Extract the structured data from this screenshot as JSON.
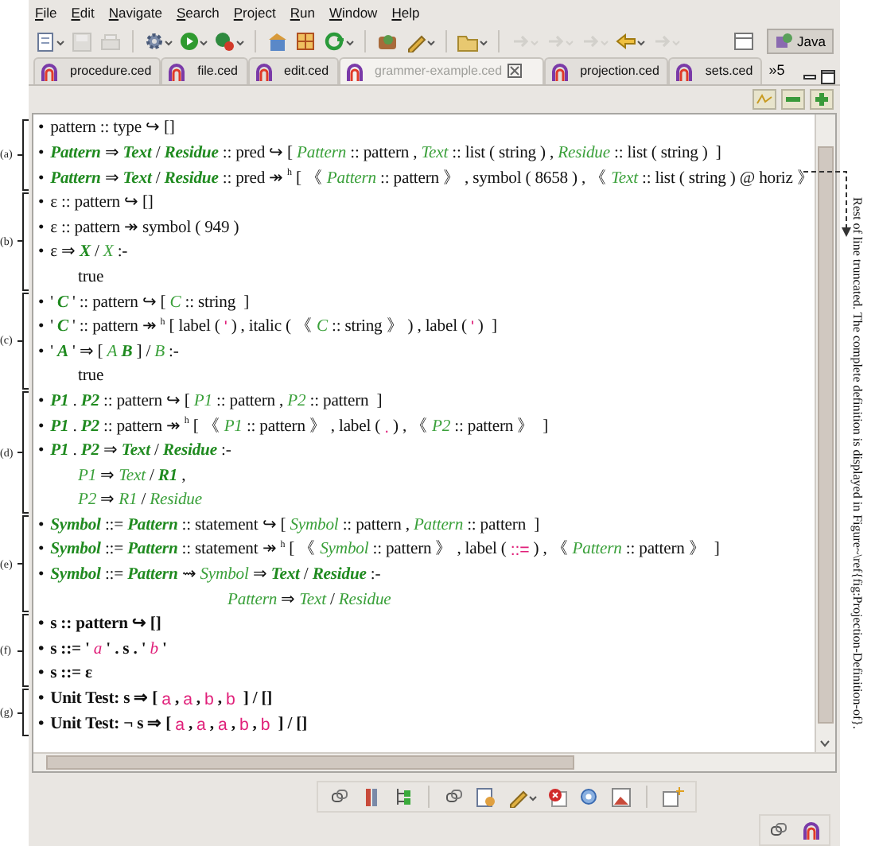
{
  "menu": [
    {
      "label": "File"
    },
    {
      "label": "Edit"
    },
    {
      "label": "Navigate"
    },
    {
      "label": "Search"
    },
    {
      "label": "Project"
    },
    {
      "label": "Run"
    },
    {
      "label": "Window"
    },
    {
      "label": "Help"
    }
  ],
  "perspective": {
    "label": "Java",
    "selected": true
  },
  "tabs": [
    {
      "label": "procedure.ced",
      "selected": false
    },
    {
      "label": "file.ced",
      "selected": false
    },
    {
      "label": "edit.ced",
      "selected": false
    },
    {
      "label": "grammer-example.ced",
      "selected": true
    },
    {
      "label": "projection.ced",
      "selected": false
    },
    {
      "label": "sets.ced",
      "selected": false
    }
  ],
  "tab_overflow": "»5",
  "groups": [
    {
      "label": "(a)",
      "strong": false,
      "lines": [
        {
          "kind": "item",
          "bullet": "•",
          "segs": [
            {
              "kind": "plain",
              "text": "pattern :: type ↪ []"
            }
          ]
        },
        {
          "kind": "item",
          "bullet": "•",
          "segs": [
            {
              "kind": "var",
              "text": "Pattern"
            },
            {
              "kind": "plain",
              "text": " ⇒ "
            },
            {
              "kind": "var",
              "text": "Text"
            },
            {
              "kind": "plain",
              "text": " / "
            },
            {
              "kind": "var",
              "text": "Residue"
            },
            {
              "kind": "plain",
              "text": " :: pred ↪ [ "
            },
            {
              "kind": "param",
              "text": "Pattern"
            },
            {
              "kind": "plain",
              "text": " :: pattern , "
            },
            {
              "kind": "param",
              "text": "Text"
            },
            {
              "kind": "plain",
              "text": " :: list ( string ) , "
            },
            {
              "kind": "param",
              "text": "Residue"
            },
            {
              "kind": "plain",
              "text": " :: list ( string )  ]"
            }
          ]
        },
        {
          "kind": "item",
          "bullet": "•",
          "segs": [
            {
              "kind": "var",
              "text": "Pattern"
            },
            {
              "kind": "plain",
              "text": " ⇒ "
            },
            {
              "kind": "var",
              "text": "Text"
            },
            {
              "kind": "plain",
              "text": " / "
            },
            {
              "kind": "var",
              "text": "Residue"
            },
            {
              "kind": "plain",
              "text": " :: pred ↠ "
            },
            {
              "kind": "sup",
              "text": "h"
            },
            {
              "kind": "plain",
              "text": " [ 《 "
            },
            {
              "kind": "param",
              "text": "Pattern"
            },
            {
              "kind": "plain",
              "text": " :: pattern 》 , symbol ( 8658 ) , 《 "
            },
            {
              "kind": "param",
              "text": "Text"
            },
            {
              "kind": "plain",
              "text": " :: list ( string ) @ horiz 》"
            }
          ]
        }
      ]
    },
    {
      "label": "(b)",
      "strong": false,
      "lines": [
        {
          "kind": "item",
          "bullet": "•",
          "segs": [
            {
              "kind": "plain",
              "text": "ε :: pattern ↪ []"
            }
          ]
        },
        {
          "kind": "item",
          "bullet": "•",
          "segs": [
            {
              "kind": "plain",
              "text": "ε :: pattern ↠ symbol ( 949 )"
            }
          ]
        },
        {
          "kind": "item",
          "bullet": "•",
          "segs": [
            {
              "kind": "plain",
              "text": "ε ⇒ "
            },
            {
              "kind": "var",
              "text": "X"
            },
            {
              "kind": "plain",
              "text": " / "
            },
            {
              "kind": "param",
              "text": "X"
            },
            {
              "kind": "plain",
              "text": " :-"
            }
          ]
        },
        {
          "kind": "cont",
          "segs": [
            {
              "kind": "plain",
              "text": "true"
            }
          ]
        }
      ]
    },
    {
      "label": "(c)",
      "strong": false,
      "lines": [
        {
          "kind": "item",
          "bullet": "•",
          "segs": [
            {
              "kind": "plain",
              "text": "' "
            },
            {
              "kind": "var",
              "text": "C"
            },
            {
              "kind": "plain",
              "text": " ' :: pattern ↪ [ "
            },
            {
              "kind": "param",
              "text": "C"
            },
            {
              "kind": "plain",
              "text": " :: string  ]"
            }
          ]
        },
        {
          "kind": "item",
          "bullet": "•",
          "segs": [
            {
              "kind": "plain",
              "text": "' "
            },
            {
              "kind": "var",
              "text": "C"
            },
            {
              "kind": "plain",
              "text": " ' :: pattern ↠ "
            },
            {
              "kind": "sup",
              "text": "h"
            },
            {
              "kind": "plain",
              "text": " [ label ( "
            },
            {
              "kind": "literal",
              "text": "'"
            },
            {
              "kind": "plain",
              "text": " ) , italic ( 《 "
            },
            {
              "kind": "param",
              "text": "C"
            },
            {
              "kind": "plain",
              "text": " :: string 》 ) , label ( "
            },
            {
              "kind": "literal",
              "text": "'"
            },
            {
              "kind": "plain",
              "text": " )  ]"
            }
          ]
        },
        {
          "kind": "item",
          "bullet": "•",
          "segs": [
            {
              "kind": "plain",
              "text": "' "
            },
            {
              "kind": "var",
              "text": "A"
            },
            {
              "kind": "plain",
              "text": " ' ⇒ [ "
            },
            {
              "kind": "param",
              "text": "A"
            },
            {
              "kind": "var",
              "text": " B"
            },
            {
              "kind": "plain",
              "text": " ] / "
            },
            {
              "kind": "param",
              "text": "B"
            },
            {
              "kind": "plain",
              "text": " :-"
            }
          ]
        },
        {
          "kind": "cont",
          "segs": [
            {
              "kind": "plain",
              "text": "true"
            }
          ]
        }
      ]
    },
    {
      "label": "(d)",
      "strong": false,
      "lines": [
        {
          "kind": "item",
          "bullet": "•",
          "segs": [
            {
              "kind": "var",
              "text": "P1"
            },
            {
              "kind": "plain",
              "text": " . "
            },
            {
              "kind": "var",
              "text": "P2"
            },
            {
              "kind": "plain",
              "text": " :: pattern ↪ [ "
            },
            {
              "kind": "param",
              "text": "P1"
            },
            {
              "kind": "plain",
              "text": " :: pattern , "
            },
            {
              "kind": "param",
              "text": "P2"
            },
            {
              "kind": "plain",
              "text": " :: pattern  ]"
            }
          ]
        },
        {
          "kind": "item",
          "bullet": "•",
          "segs": [
            {
              "kind": "var",
              "text": "P1"
            },
            {
              "kind": "plain",
              "text": " . "
            },
            {
              "kind": "var",
              "text": "P2"
            },
            {
              "kind": "plain",
              "text": " :: pattern ↠ "
            },
            {
              "kind": "sup",
              "text": "h"
            },
            {
              "kind": "plain",
              "text": " [ 《 "
            },
            {
              "kind": "param",
              "text": "P1"
            },
            {
              "kind": "plain",
              "text": " :: pattern 》 , label ( "
            },
            {
              "kind": "literal",
              "text": "."
            },
            {
              "kind": "plain",
              "text": " ) , 《 "
            },
            {
              "kind": "param",
              "text": "P2"
            },
            {
              "kind": "plain",
              "text": " :: pattern 》  ]"
            }
          ]
        },
        {
          "kind": "item",
          "bullet": "•",
          "segs": [
            {
              "kind": "var",
              "text": "P1"
            },
            {
              "kind": "plain",
              "text": " . "
            },
            {
              "kind": "var",
              "text": "P2"
            },
            {
              "kind": "plain",
              "text": " ⇒ "
            },
            {
              "kind": "var",
              "text": "Text"
            },
            {
              "kind": "plain",
              "text": " / "
            },
            {
              "kind": "var",
              "text": "Residue"
            },
            {
              "kind": "plain",
              "text": " :-"
            }
          ]
        },
        {
          "kind": "cont",
          "segs": [
            {
              "kind": "param",
              "text": "P1"
            },
            {
              "kind": "plain",
              "text": " ⇒ "
            },
            {
              "kind": "param",
              "text": "Text"
            },
            {
              "kind": "plain",
              "text": " / "
            },
            {
              "kind": "var",
              "text": "R1"
            },
            {
              "kind": "plain",
              "text": " ,"
            }
          ]
        },
        {
          "kind": "cont",
          "segs": [
            {
              "kind": "param",
              "text": "P2"
            },
            {
              "kind": "plain",
              "text": " ⇒ "
            },
            {
              "kind": "param",
              "text": "R1"
            },
            {
              "kind": "plain",
              "text": " / "
            },
            {
              "kind": "param",
              "text": "Residue"
            }
          ]
        }
      ]
    },
    {
      "label": "(e)",
      "strong": false,
      "lines": [
        {
          "kind": "item",
          "bullet": "•",
          "segs": [
            {
              "kind": "var",
              "text": "Symbol"
            },
            {
              "kind": "plain",
              "text": " ::= "
            },
            {
              "kind": "var",
              "text": "Pattern"
            },
            {
              "kind": "plain",
              "text": " :: statement ↪ [ "
            },
            {
              "kind": "param",
              "text": "Symbol"
            },
            {
              "kind": "plain",
              "text": " :: pattern , "
            },
            {
              "kind": "param",
              "text": "Pattern"
            },
            {
              "kind": "plain",
              "text": " :: pattern  ]"
            }
          ]
        },
        {
          "kind": "item",
          "bullet": "•",
          "segs": [
            {
              "kind": "var",
              "text": "Symbol"
            },
            {
              "kind": "plain",
              "text": " ::= "
            },
            {
              "kind": "var",
              "text": "Pattern"
            },
            {
              "kind": "plain",
              "text": " :: statement ↠ "
            },
            {
              "kind": "sup",
              "text": "h"
            },
            {
              "kind": "plain",
              "text": " [ 《 "
            },
            {
              "kind": "param",
              "text": "Symbol"
            },
            {
              "kind": "plain",
              "text": " :: pattern 》 , label ( "
            },
            {
              "kind": "literal",
              "text": "::="
            },
            {
              "kind": "plain",
              "text": " ) , 《 "
            },
            {
              "kind": "param",
              "text": "Pattern"
            },
            {
              "kind": "plain",
              "text": " :: pattern 》  ]"
            }
          ]
        },
        {
          "kind": "item",
          "bullet": "•",
          "segs": [
            {
              "kind": "var",
              "text": "Symbol"
            },
            {
              "kind": "plain",
              "text": " ::= "
            },
            {
              "kind": "var",
              "text": "Pattern"
            },
            {
              "kind": "plain",
              "text": " ⇝ "
            },
            {
              "kind": "param",
              "text": "Symbol"
            },
            {
              "kind": "plain",
              "text": " ⇒ "
            },
            {
              "kind": "var",
              "text": "Text"
            },
            {
              "kind": "plain",
              "text": " / "
            },
            {
              "kind": "var",
              "text": "Residue"
            },
            {
              "kind": "plain",
              "text": " :-"
            }
          ]
        },
        {
          "kind": "deep",
          "segs": [
            {
              "kind": "param",
              "text": "Pattern"
            },
            {
              "kind": "plain",
              "text": " ⇒ "
            },
            {
              "kind": "param",
              "text": "Text"
            },
            {
              "kind": "plain",
              "text": " / "
            },
            {
              "kind": "param",
              "text": "Residue"
            }
          ]
        }
      ]
    },
    {
      "label": "(f)",
      "strong": true,
      "lines": [
        {
          "kind": "item",
          "bullet": "•",
          "segs": [
            {
              "kind": "plain",
              "text": "s :: pattern ↪ []"
            }
          ]
        },
        {
          "kind": "item",
          "bullet": "•",
          "segs": [
            {
              "kind": "plain",
              "text": "s ::= ' "
            },
            {
              "kind": "literal-italic",
              "text": "a"
            },
            {
              "kind": "plain",
              "text": " ' . s . ' "
            },
            {
              "kind": "literal-italic",
              "text": "b"
            },
            {
              "kind": "plain",
              "text": " '"
            }
          ]
        },
        {
          "kind": "item",
          "bullet": "•",
          "segs": [
            {
              "kind": "plain",
              "text": "s ::= ε"
            }
          ]
        }
      ]
    },
    {
      "label": "(g)",
      "strong": true,
      "lines": [
        {
          "kind": "item",
          "bullet": "•",
          "segs": [
            {
              "kind": "plain",
              "text": "Unit Test: s ⇒ [ "
            },
            {
              "kind": "literal",
              "text": "a"
            },
            {
              "kind": "plain",
              "text": " , "
            },
            {
              "kind": "literal",
              "text": "a"
            },
            {
              "kind": "plain",
              "text": " , "
            },
            {
              "kind": "literal",
              "text": "b"
            },
            {
              "kind": "plain",
              "text": " , "
            },
            {
              "kind": "literal",
              "text": "b"
            },
            {
              "kind": "plain",
              "text": "  ] / []"
            }
          ]
        },
        {
          "kind": "item",
          "bullet": "•",
          "segs": [
            {
              "kind": "plain",
              "text": "Unit Test: ¬ s ⇒ [ "
            },
            {
              "kind": "literal",
              "text": "a"
            },
            {
              "kind": "plain",
              "text": " , "
            },
            {
              "kind": "literal",
              "text": "a"
            },
            {
              "kind": "plain",
              "text": " , "
            },
            {
              "kind": "literal",
              "text": "a"
            },
            {
              "kind": "plain",
              "text": " , "
            },
            {
              "kind": "literal",
              "text": "b"
            },
            {
              "kind": "plain",
              "text": " , "
            },
            {
              "kind": "literal",
              "text": "b"
            },
            {
              "kind": "plain",
              "text": "  ] / []"
            }
          ]
        }
      ]
    }
  ],
  "side_note": "Rest of line truncated. The complete definition is displayed in Figure~\\ref{fig:Projection-Definition-of}."
}
